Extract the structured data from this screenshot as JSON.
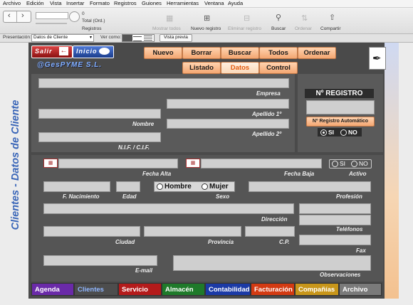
{
  "menubar": {
    "items": [
      "Archivo",
      "Edición",
      "Vista",
      "Insertar",
      "Formato",
      "Registros",
      "Guiones",
      "Herramientas",
      "Ventana",
      "Ayuda"
    ]
  },
  "toolbar": {
    "record_value": "0",
    "total_label": "Total (Ord.)",
    "registros_label": "Registros",
    "mostrar_todos": "Mostrar todos",
    "nuevo_registro": "Nuevo registro",
    "eliminar_registro": "Eliminar registro",
    "buscar": "Buscar",
    "ordenar": "Ordenar",
    "compartir": "Compartir"
  },
  "layoutbar": {
    "presentacion_label": "Presentación:",
    "presentacion_value": "Datos de Cliente",
    "ver_como_label": "Ver como:",
    "vista_previa": "Vista previa"
  },
  "vertical_title": "Clientes - Datos de Cliente",
  "nav": {
    "salir": "Salir",
    "inicio": "Inicio",
    "company": "@GesPYME S.L."
  },
  "actions": {
    "nuevo": "Nuevo",
    "borrar": "Borrar",
    "buscar": "Buscar",
    "todos": "Todos",
    "ordenar": "Ordenar"
  },
  "subtabs": {
    "listado": "Listado",
    "datos": "Datos",
    "control": "Control"
  },
  "labels": {
    "empresa": "Empresa",
    "apellido1": "Apellido 1º",
    "nombre": "Nombre",
    "apellido2": "Apellido 2º",
    "nif": "N.I.F. / C.I.F.",
    "n_registro": "Nº REGISTRO",
    "registro_auto": "Nº Registro Automático",
    "si": "SI",
    "no": "NO",
    "fecha_alta": "Fecha Alta",
    "fecha_baja": "Fecha Baja",
    "activo": "Activo",
    "f_nacimiento": "F. Nacimiento",
    "edad": "Edad",
    "hombre": "Hombre",
    "mujer": "Mujer",
    "sexo": "Sexo",
    "profesion": "Profesión",
    "direccion": "Dirección",
    "telefonos": "Teléfonos",
    "ciudad": "Ciudad",
    "provincia": "Provincia",
    "cp": "C.P.",
    "fax": "Fax",
    "email": "E-mail",
    "observaciones": "Observaciones"
  },
  "tabs": [
    {
      "label": "Agenda",
      "color": "#6a2aa8"
    },
    {
      "label": "Clientes",
      "color": "#4d4d4d"
    },
    {
      "label": "Servicio",
      "color": "#b41b1b"
    },
    {
      "label": "Almacén",
      "color": "#1f7a2a"
    },
    {
      "label": "Contabilidad",
      "color": "#1b3aa6"
    },
    {
      "label": "Facturación",
      "color": "#d33a12"
    },
    {
      "label": "Compañías",
      "color": "#c8961a"
    },
    {
      "label": "Archivo",
      "color": "#7a7a7a"
    }
  ]
}
